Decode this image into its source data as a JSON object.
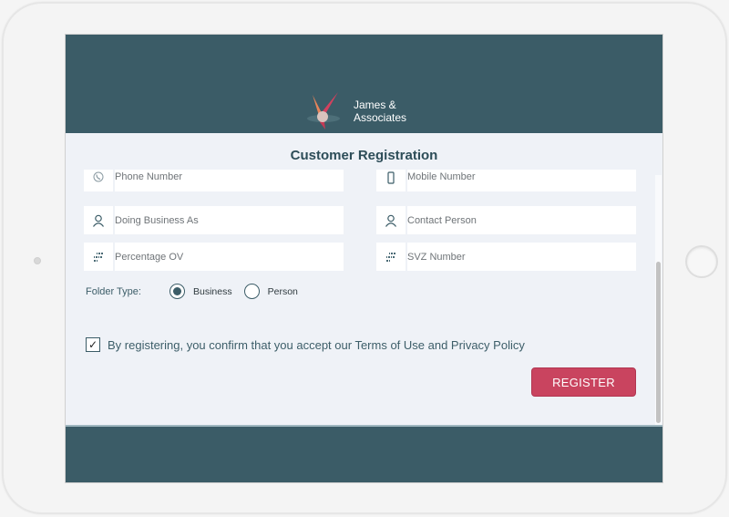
{
  "brand": {
    "name_line1": "James &",
    "name_line2": "Associates",
    "logo_icon": "hummingbird-logo-icon"
  },
  "form": {
    "title": "Customer Registration",
    "fields": [
      {
        "placeholder": "Phone Number",
        "icon": "phone-icon",
        "value": ""
      },
      {
        "placeholder": "Mobile Number",
        "icon": "mobile-icon",
        "value": ""
      },
      {
        "placeholder": "Doing Business As",
        "icon": "user-icon",
        "value": ""
      },
      {
        "placeholder": "Contact Person",
        "icon": "user-icon",
        "value": ""
      },
      {
        "placeholder": "Percentage OV",
        "icon": "binary-number-icon",
        "value": ""
      },
      {
        "placeholder": "SVZ Number",
        "icon": "binary-number-icon",
        "value": ""
      }
    ],
    "folder_type": {
      "label": "Folder Type:",
      "options": [
        "Business",
        "Person"
      ],
      "selected": "Business"
    },
    "terms": {
      "checked": true,
      "check_glyph": "✓",
      "text": "By registering, you confirm that you accept our Terms of Use and Privacy Policy"
    },
    "register_label": "REGISTER"
  },
  "colors": {
    "primary": "#3b5c67",
    "accent": "#c9445f",
    "background": "#eff2f7"
  }
}
